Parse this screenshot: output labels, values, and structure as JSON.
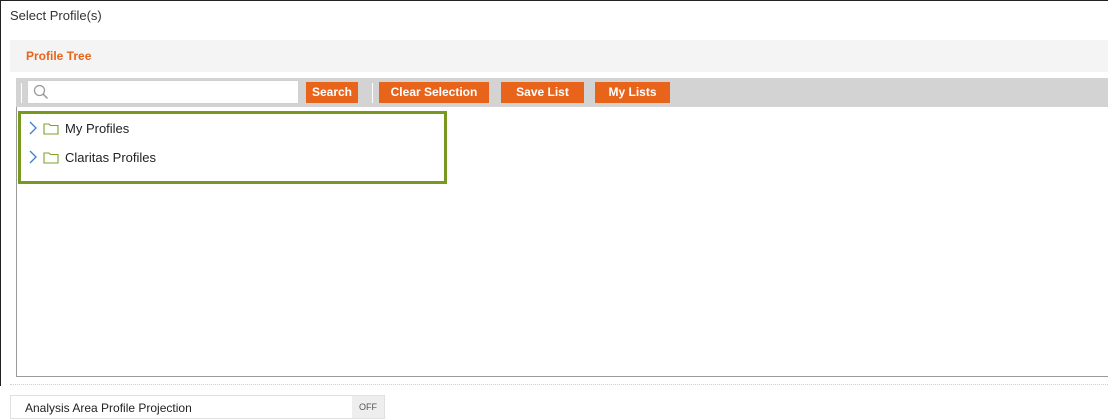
{
  "window": {
    "title": "Select Profile(s)"
  },
  "panel": {
    "title": "Profile Tree"
  },
  "toolbar": {
    "search_placeholder": "",
    "search_label": "Search",
    "clear_label": "Clear Selection",
    "save_label": "Save List",
    "lists_label": "My Lists"
  },
  "tree": {
    "items": [
      {
        "label": "My Profiles",
        "icon": "folder-icon",
        "expand_icon": "chevron-right-icon"
      },
      {
        "label": "Claritas Profiles",
        "icon": "folder-icon",
        "expand_icon": "chevron-right-icon"
      }
    ]
  },
  "projection": {
    "label": "Analysis Area Profile Projection",
    "toggle_state": "OFF"
  },
  "colors": {
    "accent": "#e8641b",
    "highlight": "#77991f",
    "folder": "#7aa32b",
    "chevron": "#3b7dd8"
  }
}
